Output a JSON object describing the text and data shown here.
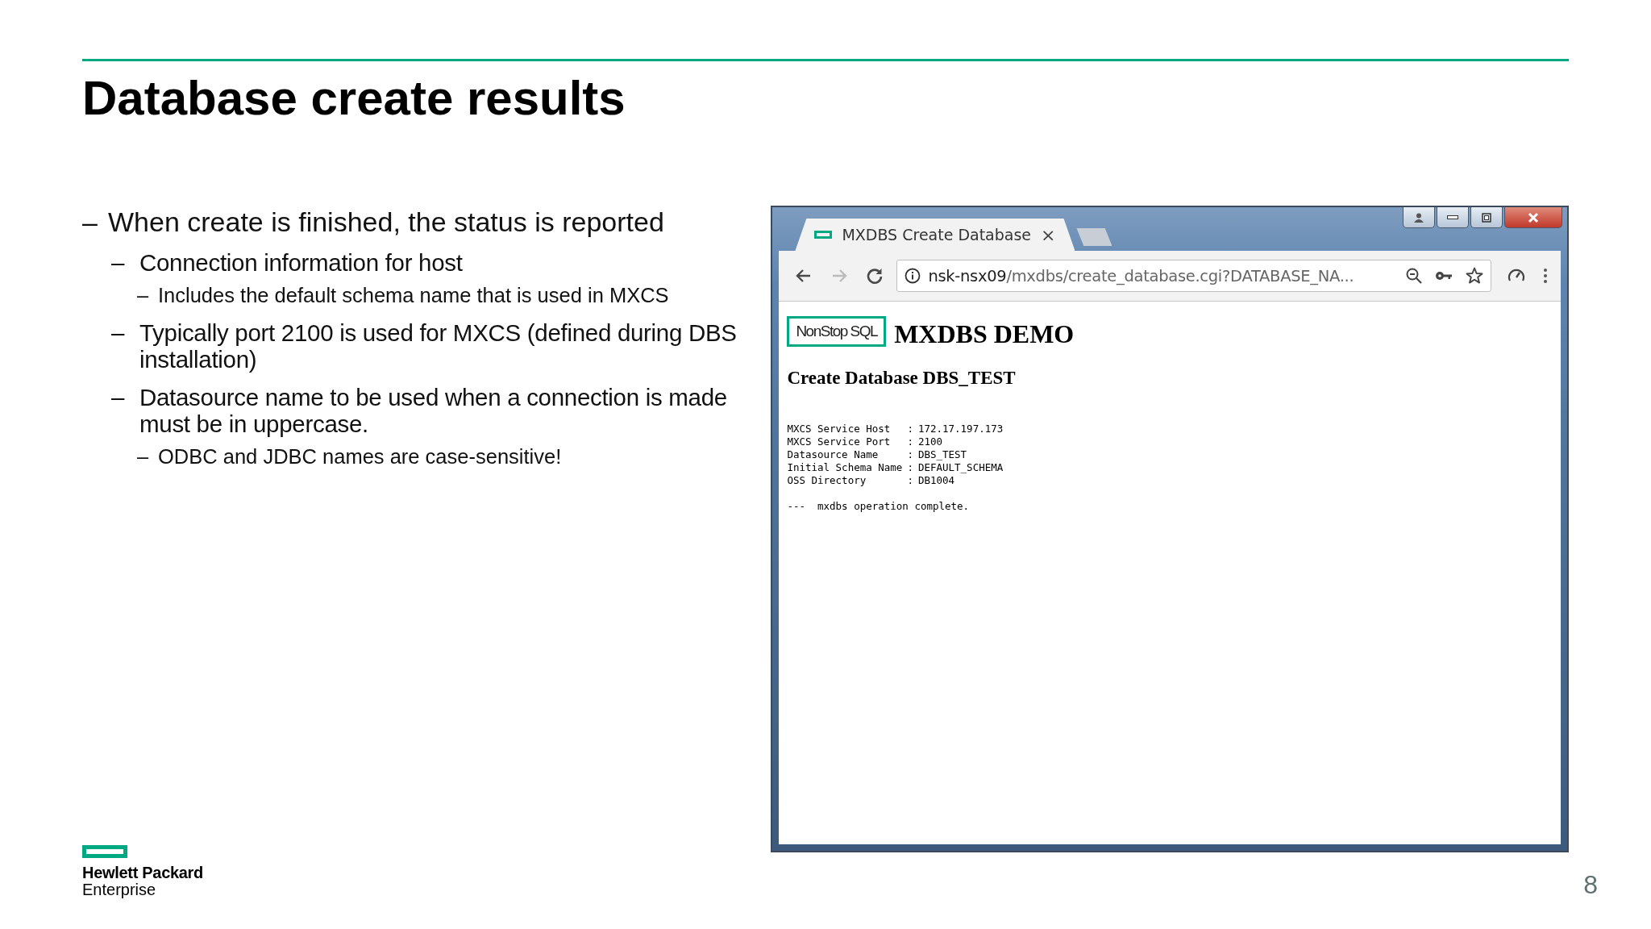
{
  "slide": {
    "title": "Database create results",
    "page_number": "8"
  },
  "bullets": [
    {
      "marker": "–",
      "text": "When create is finished, the status is reported",
      "children": [
        {
          "marker": "–",
          "text": "Connection information for host",
          "children": [
            {
              "marker": "–",
              "text": "Includes the default schema name that is used in MXCS"
            }
          ]
        },
        {
          "marker": "–",
          "text": "Typically port 2100 is used for MXCS (defined during DBS installation)"
        },
        {
          "marker": "–",
          "text": "Datasource name to be used when a connection is made must be in uppercase.",
          "children": [
            {
              "marker": "–",
              "text": "ODBC and JDBC names are case-sensitive!"
            }
          ]
        }
      ]
    }
  ],
  "logo": {
    "company": "Hewlett Packard",
    "division": "Enterprise"
  },
  "browser": {
    "tab": {
      "title": "MXDBS Create Database",
      "close": "×",
      "selected": true
    },
    "nav": [
      {
        "kind": "back",
        "disabled": false
      },
      {
        "kind": "forward",
        "disabled": true
      },
      {
        "kind": "reload",
        "disabled": false
      }
    ],
    "url": {
      "host": "nsk-nsx09",
      "path": "/mxdbs/create_database.cgi?DATABASE_NA..."
    },
    "page": {
      "logo": "NonStop SQL",
      "heading": "MXDBS DEMO",
      "subheading": "Create Database DBS_TEST",
      "separator": ":",
      "info": [
        {
          "label": "MXCS Service Host",
          "value": "172.17.197.173"
        },
        {
          "label": "MXCS Service Port",
          "value": "2100"
        },
        {
          "label": "Datasource Name",
          "value": "DBS_TEST"
        },
        {
          "label": "Initial Schema Name",
          "value": "DEFAULT_SCHEMA"
        },
        {
          "label": "OSS Directory",
          "value": "DB1004"
        }
      ],
      "status": "---  mxdbs operation complete."
    }
  }
}
